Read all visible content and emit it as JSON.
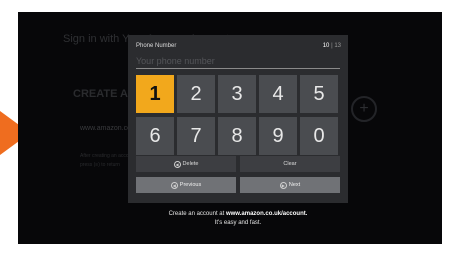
{
  "background": {
    "title": "Sign in with Your Amazon Account",
    "create_heading": "CREATE ACCOUNT",
    "url": "www.amazon.co.uk/account",
    "after_text": "After creating an account,",
    "press_text": "press (≡) to return"
  },
  "dialog": {
    "title": "Phone Number",
    "counter_current": "10",
    "counter_total": "13",
    "input_placeholder": "Your phone number",
    "input_value": "",
    "keys": [
      "1",
      "2",
      "3",
      "4",
      "5",
      "6",
      "7",
      "8",
      "9",
      "0"
    ],
    "focused_key": "1",
    "delete_label": "Delete",
    "clear_label": "Clear",
    "previous_label": "Previous",
    "next_label": "Next"
  },
  "footer": {
    "line1_prefix": "Create an account at",
    "line1_url": "www.amazon.co.uk/account.",
    "line2": "It's easy and fast."
  },
  "colors": {
    "accent_arrow": "#ef6d1f",
    "focused_key": "#f2a81c",
    "dialog_bg": "#2b2c2f",
    "key_bg": "#4a4c50"
  },
  "icons": {
    "delete": "rewind-icon",
    "previous": "rewind-icon",
    "next": "fast-forward-icon",
    "background": "plus-icon"
  }
}
